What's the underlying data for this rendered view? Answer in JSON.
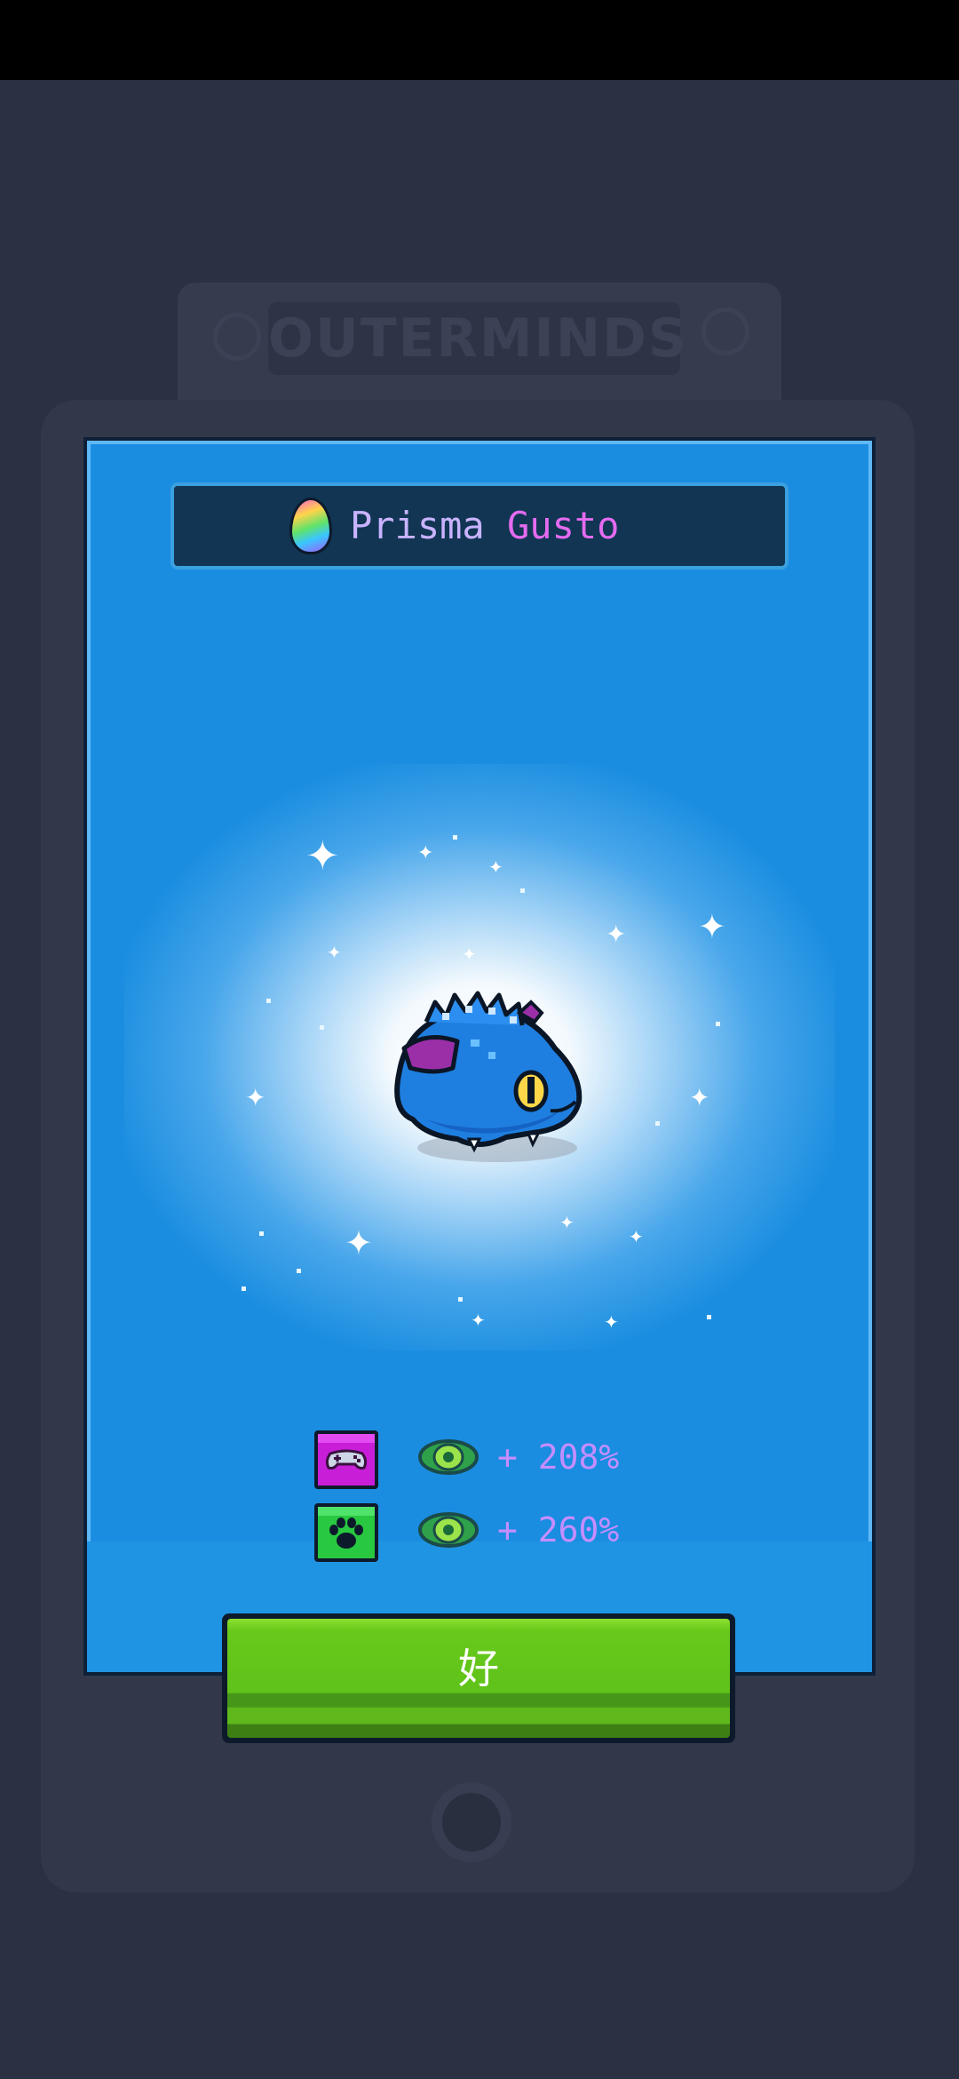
{
  "background": {
    "logo_text": "OUTERMINDS"
  },
  "card": {
    "title_word1": "Prisma",
    "title_word2": "Gusto",
    "egg_icon": "rainbow-egg-icon"
  },
  "creature": {
    "icon": "blue-fish-creature"
  },
  "bonuses": [
    {
      "category_icon": "gamepad-icon",
      "category_color": "#c81ed8",
      "stat_icon": "eye-icon",
      "text": "+ 208%"
    },
    {
      "category_icon": "paw-icon",
      "category_color": "#28c840",
      "stat_icon": "eye-icon",
      "text": "+ 260%"
    }
  ],
  "ok_button": {
    "label": "好"
  },
  "colors": {
    "card_blue": "#1a8de0",
    "button_green": "#5fc21a",
    "bonus_text": "#c58dff"
  }
}
